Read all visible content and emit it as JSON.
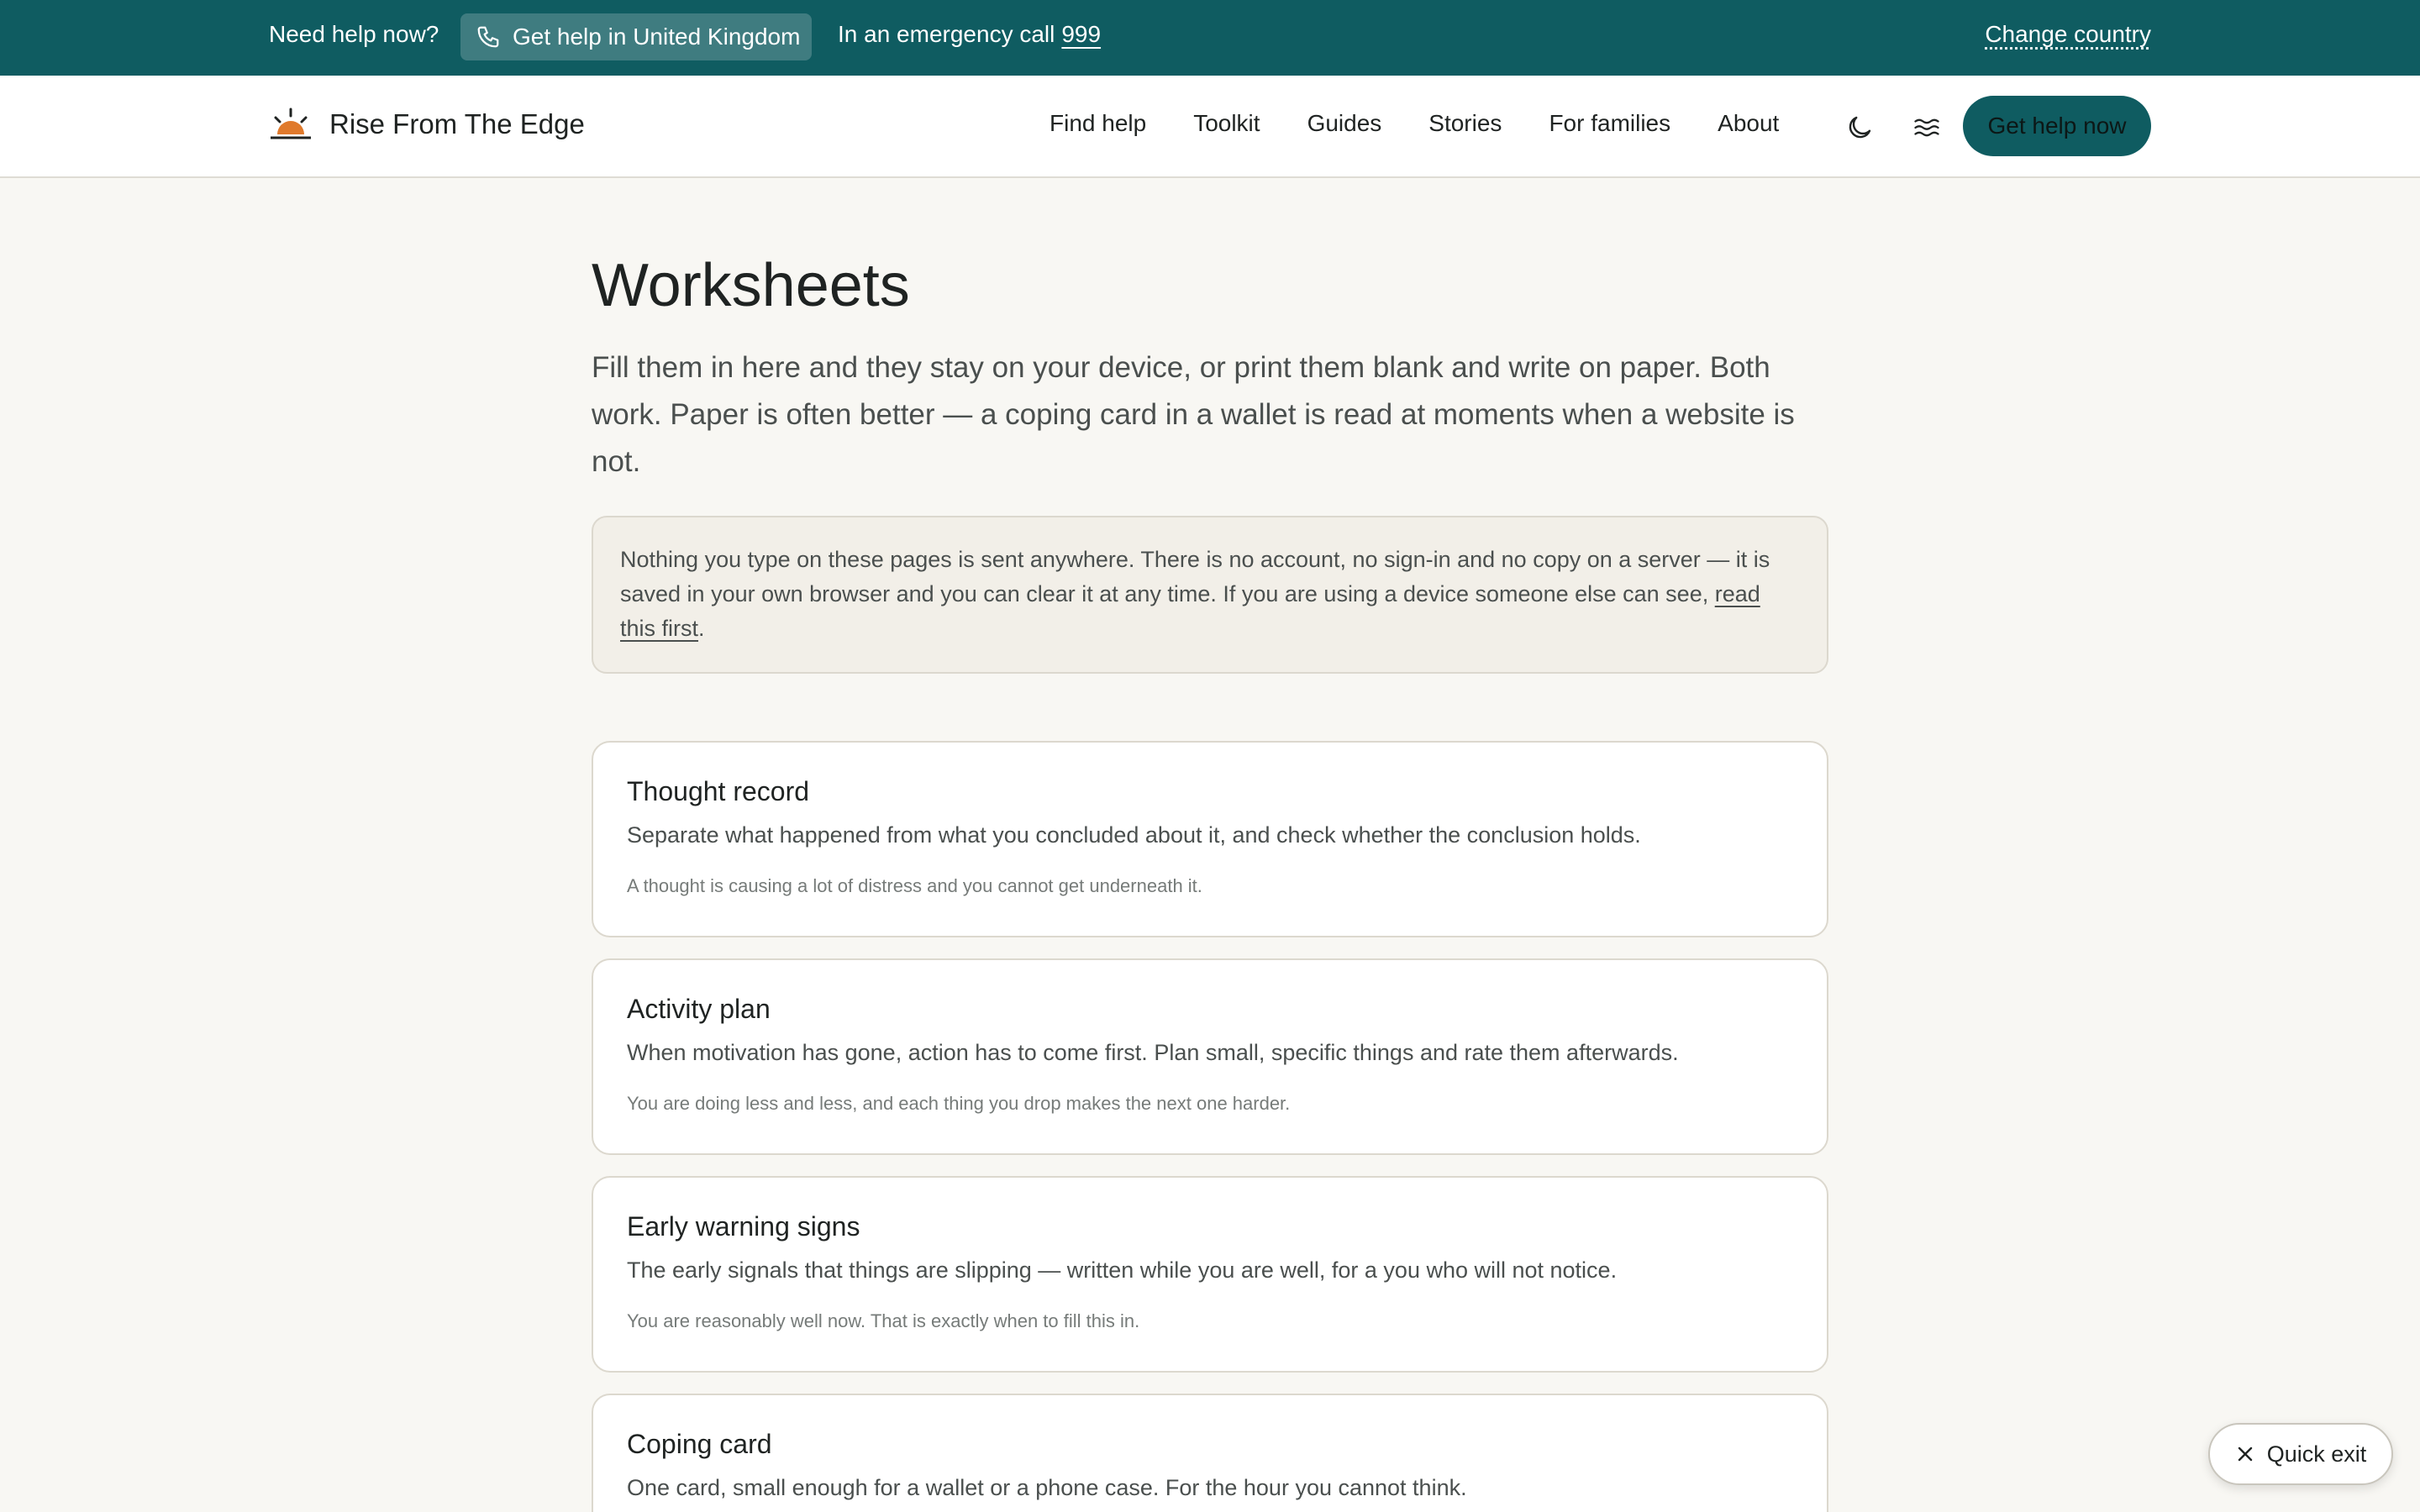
{
  "topbar": {
    "need_help": "Need help now?",
    "help_button": "Get help in United Kingdom",
    "emergency_text": "In an emergency call",
    "emergency_number": "999",
    "change_country": "Change country"
  },
  "header": {
    "site_name": "Rise From The Edge",
    "nav": [
      "Find help",
      "Toolkit",
      "Guides",
      "Stories",
      "For families",
      "About"
    ],
    "cta": "Get help now",
    "icons": [
      "sunrise-logo-icon",
      "moon-icon",
      "waves-icon"
    ]
  },
  "main": {
    "title": "Worksheets",
    "intro": "Fill them in here and they stay on your device, or print them blank and write on paper. Both work. Paper is often better — a coping card in a wallet is read at moments when a website is not.",
    "privacy_text": "Nothing you type on these pages is sent anywhere. There is no account, no sign-in and no copy on a server — it is saved in your own browser and you can clear it at any time. If you are using a device someone else can see, ",
    "privacy_link": "read this first",
    "privacy_end": "."
  },
  "worksheets": [
    {
      "title": "Thought record",
      "description": "Separate what happened from what you concluded about it, and check whether the conclusion holds.",
      "when": "A thought is causing a lot of distress and you cannot get underneath it."
    },
    {
      "title": "Activity plan",
      "description": "When motivation has gone, action has to come first. Plan small, specific things and rate them afterwards.",
      "when": "You are doing less and less, and each thing you drop makes the next one harder."
    },
    {
      "title": "Early warning signs",
      "description": "The early signals that things are slipping — written while you are well, for a you who will not notice.",
      "when": "You are reasonably well now. That is exactly when to fill this in."
    },
    {
      "title": "Coping card",
      "description": "One card, small enough for a wallet or a phone case. For the hour you cannot think.",
      "when": ""
    }
  ],
  "quick_exit": "Quick exit",
  "colors": {
    "brand": "#0f5c61",
    "background": "#f8f7f3",
    "card": "#ffffff",
    "text": "#1f2322",
    "muted": "#4a4f4e"
  }
}
